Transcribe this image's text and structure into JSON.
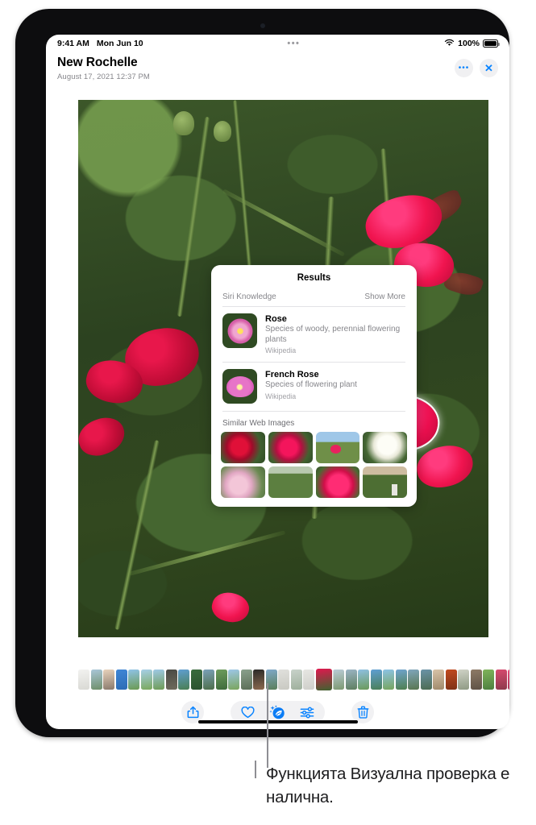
{
  "status_bar": {
    "time": "9:41 AM",
    "date": "Mon Jun 10",
    "center_indicator": "•••",
    "battery_percent": "100%",
    "wifi_icon": "wifi-icon",
    "battery_icon": "battery-full-icon"
  },
  "header": {
    "title": "New Rochelle",
    "subtitle": "August 17, 2021  12:37 PM",
    "more_button": {
      "icon": "ellipsis-icon",
      "label": "•••"
    },
    "close_button": {
      "icon": "close-icon",
      "label": "✕"
    }
  },
  "photo": {
    "name": "rose-bush-photo",
    "description": "Close-up of a rose bush with deep red and bright pink roses among dense green foliage",
    "highlighted_subject": "pink-rose-glow-outline"
  },
  "results_popover": {
    "title": "Results",
    "section_label": "Siri Knowledge",
    "show_more_label": "Show More",
    "entries": [
      {
        "title": "Rose",
        "description": "Species of woody, perennial flowering plants",
        "source": "Wikipedia",
        "thumbnail": "pink-wild-rose-thumbnail"
      },
      {
        "title": " French Rose",
        "description": "Species of flowering plant",
        "source": "Wikipedia",
        "thumbnail": "magenta-rose-thumbnail"
      }
    ],
    "similar_images_label": "Similar Web Images",
    "similar_images": [
      {
        "name": "red-rose-closeup",
        "style": "wt-red"
      },
      {
        "name": "pink-rose-bush",
        "style": "wt-pink"
      },
      {
        "name": "rose-in-field-with-sky",
        "style": "wt-field"
      },
      {
        "name": "white-roses",
        "style": "wt-white"
      },
      {
        "name": "light-pink-roses",
        "style": "wt-lpink"
      },
      {
        "name": "rose-shrub-row",
        "style": "wt-bush"
      },
      {
        "name": "magenta-rose-bud",
        "style": "wt-bigros"
      },
      {
        "name": "rose-garden-with-label",
        "style": "wt-garden"
      }
    ]
  },
  "filmstrip": {
    "name": "photo-thumbnail-strip",
    "selected_index": 19,
    "items": [
      {
        "c1": "#f2f2f0",
        "c2": "#d9d9d4"
      },
      {
        "c1": "#a9c6d8",
        "c2": "#6f8f6a"
      },
      {
        "c1": "#e8d2bb",
        "c2": "#8a7a6d"
      },
      {
        "c1": "#3f86d6",
        "c2": "#2d6cb5"
      },
      {
        "c1": "#8fc3e8",
        "c2": "#6b9a52"
      },
      {
        "c1": "#a6cfe8",
        "c2": "#7aa85c"
      },
      {
        "c1": "#9ec9e6",
        "c2": "#6f9c55"
      },
      {
        "c1": "#4a4a44",
        "c2": "#6e6a5c"
      },
      {
        "c1": "#5f9ed1",
        "c2": "#4a7f53"
      },
      {
        "c1": "#3a6b3d",
        "c2": "#2c5230"
      },
      {
        "c1": "#7aa0b8",
        "c2": "#4e6f4a"
      },
      {
        "c1": "#6d9c5c",
        "c2": "#3f6b3c"
      },
      {
        "c1": "#9dc7e8",
        "c2": "#7aa55c"
      },
      {
        "c1": "#8aa08c",
        "c2": "#5d6f58"
      },
      {
        "c1": "#2a2a28",
        "c2": "#8c6a4f"
      },
      {
        "c1": "#7fa8c9",
        "c2": "#5b7f5a"
      },
      {
        "c1": "#e0e0dc",
        "c2": "#c9c9c2"
      },
      {
        "c1": "#c8d2ca",
        "c2": "#9fb09d"
      },
      {
        "c1": "#e6e6e2",
        "c2": "#cfcfca"
      },
      {
        "c1": "#e0184e",
        "c2": "#3e6330"
      },
      {
        "c1": "#b9cbd6",
        "c2": "#7d9a72"
      },
      {
        "c1": "#9ab4c4",
        "c2": "#5f7f60"
      },
      {
        "c1": "#8ec0e2",
        "c2": "#6b9a5a"
      },
      {
        "c1": "#5f9fd4",
        "c2": "#4a7f58"
      },
      {
        "c1": "#8cc3e6",
        "c2": "#77a55e"
      },
      {
        "c1": "#6fa4cf",
        "c2": "#4e7f4f"
      },
      {
        "c1": "#7fa6bd",
        "c2": "#59764f"
      },
      {
        "c1": "#6b93a8",
        "c2": "#4c6b52"
      },
      {
        "c1": "#d8c3a8",
        "c2": "#a08a6c"
      },
      {
        "c1": "#c24a1f",
        "c2": "#7e3216"
      },
      {
        "c1": "#cfd2c6",
        "c2": "#8f9a84"
      },
      {
        "c1": "#8e7a66",
        "c2": "#5f5246"
      },
      {
        "c1": "#7fb35a",
        "c2": "#4e8040"
      },
      {
        "c1": "#d84a6f",
        "c2": "#8d3a4c"
      },
      {
        "c1": "#e84a7a",
        "c2": "#a73456"
      },
      {
        "c1": "#eaeae6",
        "c2": "#d2d2cc"
      }
    ]
  },
  "toolbar": {
    "share_button": {
      "name": "share-button",
      "icon": "share-icon"
    },
    "favorite_button": {
      "name": "favorite-button",
      "icon": "heart-icon"
    },
    "visual_lookup_button": {
      "name": "visual-lookup-button",
      "icon": "visual-lookup-icon",
      "active": true
    },
    "adjust_button": {
      "name": "adjust-button",
      "icon": "sliders-icon"
    },
    "delete_button": {
      "name": "delete-button",
      "icon": "trash-icon"
    },
    "home_indicator": "home-indicator"
  },
  "callout": {
    "text": "Функцията Визуална проверка е налична."
  },
  "colors": {
    "accent_blue": "#0a84ff",
    "toolbar_bg": "#f1f1f3",
    "secondary_text": "#86868b",
    "tertiary_text": "#a1a1a6",
    "callout_gray": "#8e8e93",
    "device_bezel": "#0d0d0f"
  }
}
